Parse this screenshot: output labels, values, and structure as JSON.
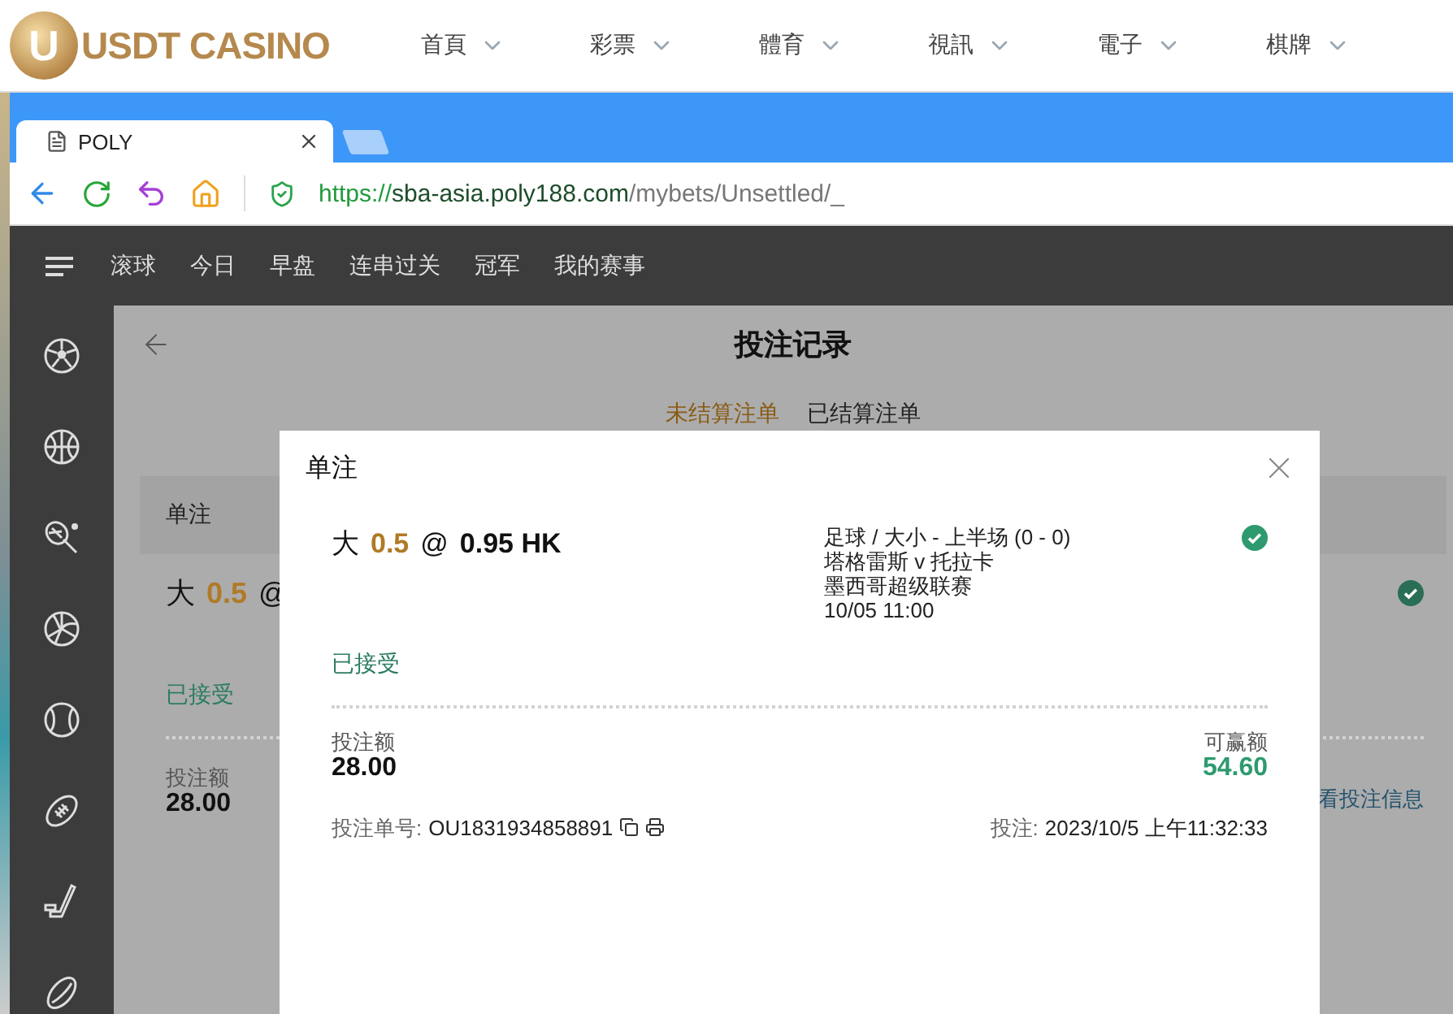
{
  "site_header": {
    "logo_mark": "U",
    "logo_text": "USDT CASINO",
    "nav": [
      "首頁",
      "彩票",
      "體育",
      "視訊",
      "電子",
      "棋牌"
    ]
  },
  "browser": {
    "tab_title": "POLY",
    "url": {
      "scheme": "https://",
      "host": "sba-asia.poly188.com",
      "path": "/mybets/Unsettled/_"
    }
  },
  "app_nav": [
    "滚球",
    "今日",
    "早盘",
    "连串过关",
    "冠军",
    "我的赛事"
  ],
  "page": {
    "title": "投注记录",
    "tabs": [
      {
        "label": "未结算注单",
        "selected": true
      },
      {
        "label": "已结算注单",
        "selected": false
      }
    ]
  },
  "background_bet": {
    "header": "单注",
    "pick": "大",
    "line": "0.5",
    "at": "@",
    "status": "已接受",
    "stake_label": "投注额",
    "stake": "28.00",
    "details_link": "看投注信息"
  },
  "bet_dialog": {
    "title": "单注",
    "pick": "大",
    "line": "0.5",
    "at": "@",
    "odds": "0.95 HK",
    "event": [
      "足球 / 大小 - 上半场 (0 - 0)",
      "塔格雷斯 v 托拉卡",
      "墨西哥超级联赛",
      "10/05 11:00"
    ],
    "status": "已接受",
    "stake_label": "投注额",
    "stake": "28.00",
    "win_label": "可赢额",
    "win": "54.60",
    "order": {
      "label": "投注单号:",
      "value": "OU1831934858891"
    },
    "placed": {
      "label": "投注:",
      "value": "2023/10/5 上午11:32:33"
    }
  }
}
